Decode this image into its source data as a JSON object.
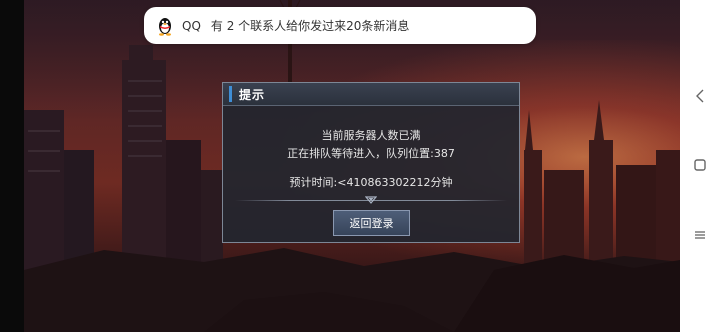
{
  "notification": {
    "app": "QQ",
    "message": "有 2 个联系人给你发过来20条新消息",
    "icon": "qq-penguin-icon"
  },
  "dialog": {
    "title": "提示",
    "line1": "当前服务器人数已满",
    "line2": "正在排队等待进入，队列位置:387",
    "eta": "预计时间:<410863302212分钟",
    "button_label": "返回登录",
    "accent_color": "#3f8ed6"
  },
  "system_nav": {
    "back_icon": "back-chevron-icon",
    "home_icon": "square-home-icon",
    "menu_icon": "hamburger-menu-icon"
  }
}
